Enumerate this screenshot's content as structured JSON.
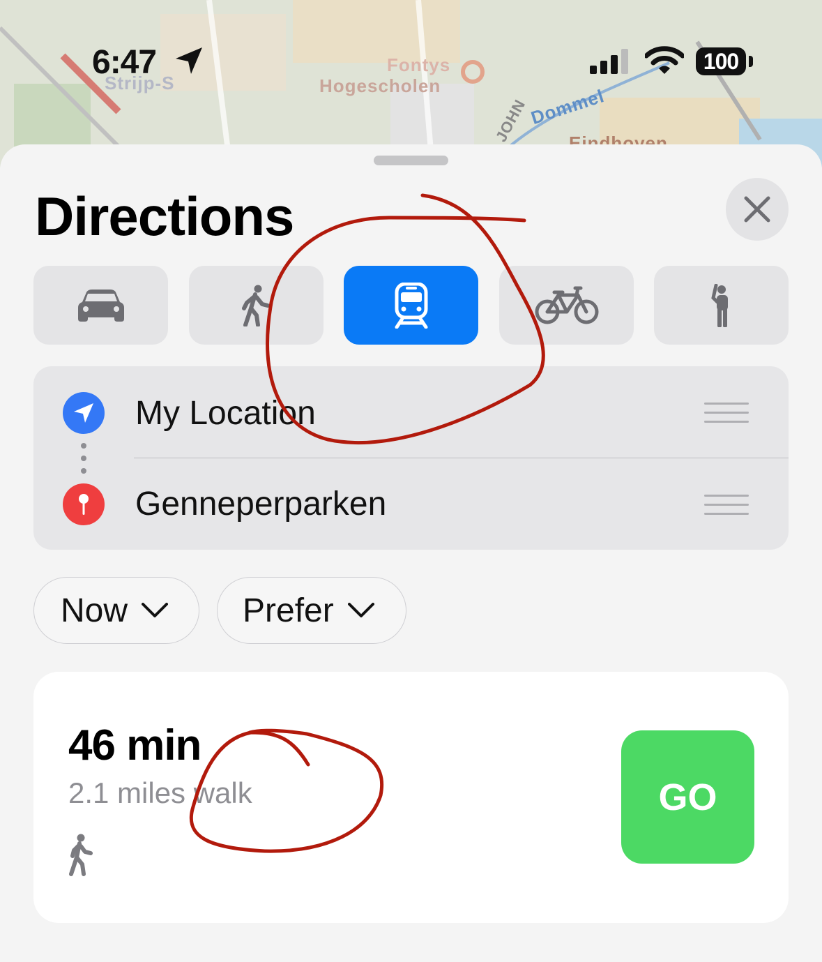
{
  "status_bar": {
    "time": "6:47",
    "battery": "100",
    "location_icon": "location-arrow-icon",
    "signal_icon": "cellular-signal-icon",
    "wifi_icon": "wifi-icon"
  },
  "map": {
    "labels": [
      "Strijp-S",
      "Hogescholen",
      "Fontys",
      "JOHN",
      "Dommel",
      "Eindhoven"
    ]
  },
  "sheet": {
    "title": "Directions",
    "close_icon": "close-icon"
  },
  "transport_modes": [
    {
      "name": "drive",
      "icon": "car-icon",
      "active": false
    },
    {
      "name": "walk",
      "icon": "walking-icon",
      "active": false
    },
    {
      "name": "transit",
      "icon": "train-icon",
      "active": true
    },
    {
      "name": "cycle",
      "icon": "bicycle-icon",
      "active": false
    },
    {
      "name": "ride",
      "icon": "hailing-person-icon",
      "active": false
    }
  ],
  "route": {
    "origin": "My Location",
    "destination": "Genneperparken"
  },
  "options": {
    "time_label": "Now",
    "prefer_label": "Prefer"
  },
  "result": {
    "duration": "46 min",
    "distance": "2.1 miles walk",
    "go_label": "GO"
  },
  "colors": {
    "active_mode": "#0a7af6",
    "go_button": "#4cd964",
    "origin_icon": "#3478f6",
    "destination_icon": "#ef3e3f",
    "annotation": "#b21a0c"
  }
}
